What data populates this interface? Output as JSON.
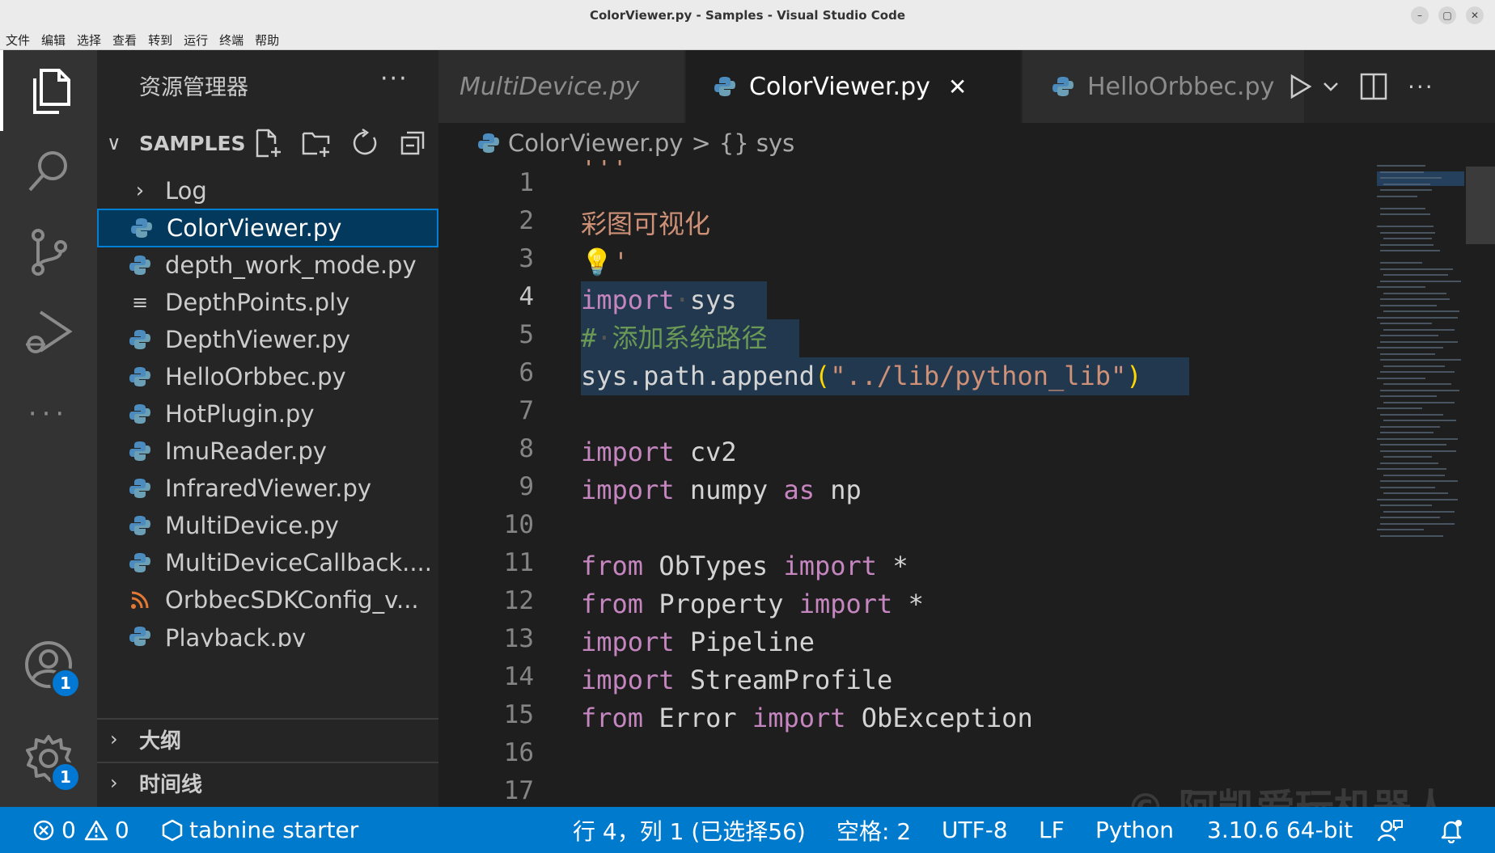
{
  "window": {
    "title": "ColorViewer.py - Samples - Visual Studio Code"
  },
  "menu": [
    "文件",
    "编辑",
    "选择",
    "查看",
    "转到",
    "运行",
    "终端",
    "帮助"
  ],
  "activity": {
    "accounts_badge": "1",
    "settings_badge": "1"
  },
  "explorer": {
    "title": "资源管理器",
    "more": "···",
    "section": "SAMPLES",
    "items": [
      {
        "name": "Log",
        "type": "folder"
      },
      {
        "name": "ColorViewer.py",
        "type": "python",
        "selected": true
      },
      {
        "name": "depth_work_mode.py",
        "type": "python"
      },
      {
        "name": "DepthPoints.ply",
        "type": "text"
      },
      {
        "name": "DepthViewer.py",
        "type": "python"
      },
      {
        "name": "HelloOrbbec.py",
        "type": "python"
      },
      {
        "name": "HotPlugin.py",
        "type": "python"
      },
      {
        "name": "ImuReader.py",
        "type": "python"
      },
      {
        "name": "InfraredViewer.py",
        "type": "python"
      },
      {
        "name": "MultiDevice.py",
        "type": "python"
      },
      {
        "name": "MultiDeviceCallback....",
        "type": "python"
      },
      {
        "name": "OrbbecSDKConfig_v...",
        "type": "rss"
      },
      {
        "name": "Playback.py",
        "type": "python"
      }
    ],
    "outline": "大纲",
    "timeline": "时间线"
  },
  "tabs": [
    {
      "label": "MultiDevice.py",
      "state": "preview"
    },
    {
      "label": "ColorViewer.py",
      "state": "active",
      "close": "✕"
    },
    {
      "label": "HelloOrbbec.py",
      "state": "inactive"
    }
  ],
  "breadcrumb": {
    "file": "ColorViewer.py",
    "sep": ">",
    "symbol": "{} sys"
  },
  "editor": {
    "line_numbers": [
      "1",
      "2",
      "3",
      "4",
      "5",
      "6",
      "7",
      "8",
      "9",
      "10",
      "11",
      "12",
      "13",
      "14",
      "15",
      "16",
      "17"
    ],
    "current_line": 4
  },
  "status": {
    "errors": "0",
    "warnings": "0",
    "tabnine": "tabnine starter",
    "position": "行 4，列 1 (已选择56)",
    "spaces": "空格: 2",
    "encoding": "UTF-8",
    "eol": "LF",
    "language": "Python",
    "interpreter": "3.10.6 64-bit"
  },
  "watermark": "© 阿凯爱玩机器人",
  "colors": {
    "accent": "#007acc",
    "selection": "#04395e",
    "keyword": "#c586c0",
    "string": "#ce9178",
    "comment": "#6a9955"
  }
}
